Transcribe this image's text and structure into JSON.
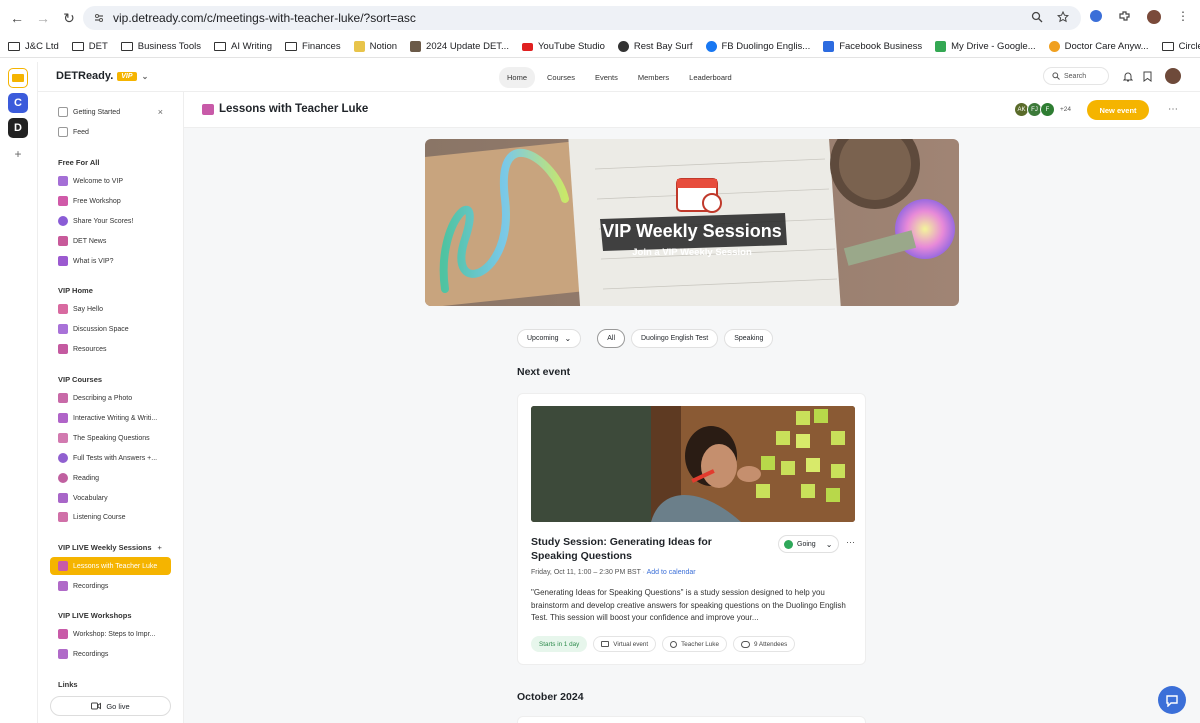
{
  "browser": {
    "url": "vip.detready.com/c/meetings-with-teacher-luke/?sort=asc",
    "bookmarks": [
      "J&C Ltd",
      "DET",
      "Business Tools",
      "AI Writing",
      "Finances",
      "Notion",
      "2024 Update DET...",
      "YouTube Studio",
      "Rest Bay Surf",
      "FB Duolingo Englis...",
      "Facebook Business",
      "My Drive - Google...",
      "Doctor Care Anyw...",
      "Circle"
    ]
  },
  "rail": {
    "letters": [
      "C",
      "D"
    ],
    "add": "+"
  },
  "header": {
    "brand": "DETReady.",
    "brand_badge": "VIP",
    "nav": [
      "Home",
      "Courses",
      "Events",
      "Members",
      "Leaderboard"
    ],
    "search_placeholder": "Search"
  },
  "sidebar": {
    "top_items": [
      "Getting Started",
      "Feed"
    ],
    "close": "×",
    "sections": [
      {
        "title": "Free For All",
        "items": [
          "Welcome to VIP",
          "Free Workshop",
          "Share Your Scores!",
          "DET News",
          "What is VIP?"
        ]
      },
      {
        "title": "VIP Home",
        "items": [
          "Say Hello",
          "Discussion Space",
          "Resources"
        ]
      },
      {
        "title": "VIP Courses",
        "items": [
          "Describing a Photo",
          "Interactive Writing & Writi...",
          "The Speaking Questions",
          "Full Tests with Answers +...",
          "Reading",
          "Vocabulary",
          "Listening Course"
        ]
      },
      {
        "title": "VIP LIVE Weekly Sessions",
        "items": [
          "Lessons with Teacher Luke",
          "Recordings"
        ]
      },
      {
        "title": "VIP LIVE Workshops",
        "items": [
          "Workshop: Steps to Impr...",
          "Recordings"
        ]
      },
      {
        "title": "Links",
        "items": []
      }
    ],
    "go_live": "Go live"
  },
  "page": {
    "title": "Lessons with Teacher Luke",
    "avatars": [
      "AK",
      "FJ",
      "F"
    ],
    "avatar_more": "+24",
    "new_event": "New event",
    "banner_title": "VIP Weekly Sessions",
    "banner_subtitle": "Join a VIP Weekly Session",
    "filter_dropdown": "Upcoming",
    "filters": [
      "All",
      "Duolingo English Test",
      "Speaking"
    ],
    "next_event_heading": "Next event",
    "month_heading": "October 2024"
  },
  "event": {
    "title": "Study Session: Generating Ideas for Speaking Questions",
    "rsvp": "Going",
    "date": "Friday, Oct 11, 1:00 – 2:30 PM BST",
    "add_to_calendar": "Add to calendar",
    "description": "\"Generating Ideas for Speaking Questions\" is a study session designed to help you brainstorm and develop creative answers for speaking  questions on the Duolingo English Test. This session will boost your confidence and improve your...",
    "tags": [
      "Starts in 1 day",
      "Virtual event",
      "Teacher Luke",
      "9 Attendees"
    ]
  },
  "colors": {
    "accent": "#f5b400",
    "link": "#3b6fd8",
    "going": "#2fa85a"
  }
}
